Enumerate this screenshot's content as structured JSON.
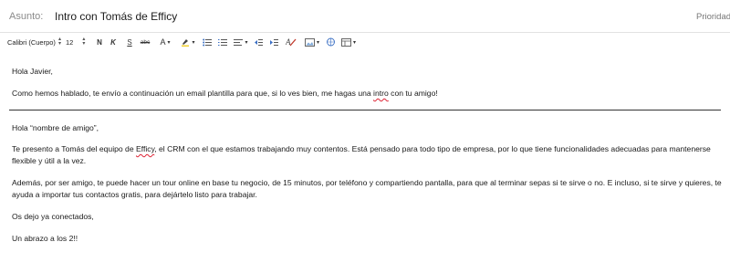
{
  "subject": {
    "label": "Asunto:",
    "value": "Intro con Tomás de Efficy",
    "priority": "Prioridad"
  },
  "toolbar": {
    "font_family": "Calibri (Cuerpo)",
    "font_size": "12",
    "bold_label": "N",
    "italic_label": "K",
    "underline_label": "S",
    "strike_label": "abc",
    "font_color_label": "A",
    "icons": [
      "font-color-icon",
      "highlight-icon",
      "bullet-list-icon",
      "numbered-list-icon",
      "align-icon",
      "decrease-indent-icon",
      "increase-indent-icon",
      "clear-format-icon",
      "picture-icon",
      "link-icon",
      "more-icon"
    ]
  },
  "email": {
    "greeting": "Hola Javier,",
    "intro_before": "Como hemos hablado, te envío a continuación un email plantilla para que, si lo ves bien, me hagas una ",
    "intro_word": "intro",
    "intro_after": " con tu amigo!",
    "template_greeting": "Hola “nombre de amigo”,",
    "p1_before": "Te presento a Tomás del equipo de ",
    "p1_word": "Efficy",
    "p1_after": ", el CRM con el que estamos trabajando muy contentos. Está pensado para todo tipo de empresa, por lo que tiene funcionalidades adecuadas para mantenerse",
    "p1_line2": "flexible y útil a la vez.",
    "p2_line1": "Además, por ser amigo, te puede hacer un tour online en base tu negocio, de 15 minutos, por teléfono y compartiendo pantalla, para que al terminar sepas si te sirve o no. E incluso, si te sirve  y quieres, te",
    "p2_line2": "ayuda a importar tus contactos gratis, para dejártelo listo para trabajar.",
    "p3": "Os dejo ya conectados,",
    "closing": "Un abrazo a los 2!!"
  }
}
